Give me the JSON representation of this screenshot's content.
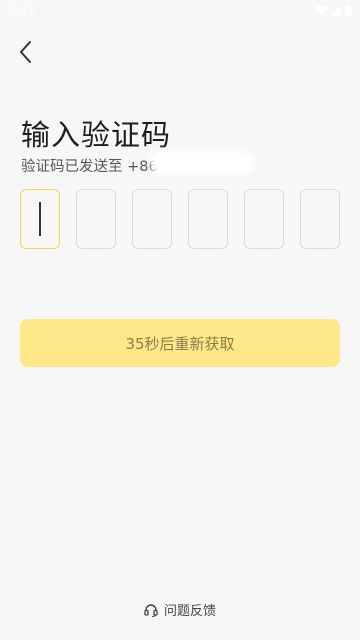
{
  "status_bar": {
    "time": "2:43"
  },
  "header": {
    "back_icon": "chevron-left-icon"
  },
  "title": "输入验证码",
  "subtitle": {
    "prefix": "验证码已发送至 ",
    "phone": "+86"
  },
  "code_input": {
    "length": 6,
    "active_index": 0
  },
  "resend_button": {
    "label": "35秒后重新获取"
  },
  "feedback": {
    "label": "问题反馈",
    "icon": "headset-icon"
  },
  "colors": {
    "background": "#f7f7f7",
    "accent": "#ffe88a",
    "accent_border": "#f3d55b",
    "button_text": "#8a7d47"
  }
}
